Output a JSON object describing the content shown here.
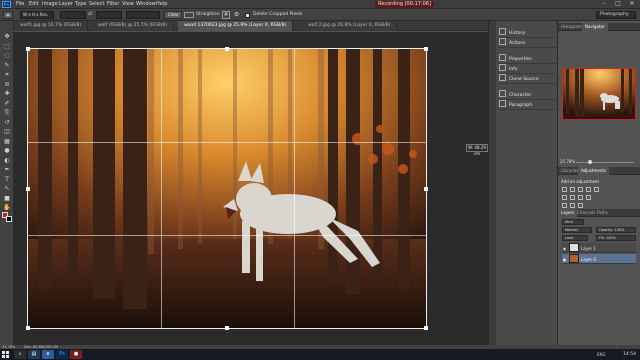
{
  "app": {
    "logo": "Ps"
  },
  "menu": [
    "File",
    "Edit",
    "Image",
    "Layer",
    "Type",
    "Select",
    "Filter",
    "View",
    "Window",
    "Help"
  ],
  "recording": "Recording [00:17:06]",
  "window_controls": [
    "–",
    "□",
    "✕"
  ],
  "options_bar": {
    "ratio": "W x H x Res.",
    "clear": "Clear",
    "straighten": "Straighten",
    "delete_cropped": "Delete Cropped Pixels",
    "workspace": "Photography"
  },
  "tabs": [
    {
      "label": "wolf1.jpg @ 16.7% (RGB/8)",
      "active": false
    },
    {
      "label": "wolf (RGB/8) @ 25.7% (RGB/8)",
      "active": false
    },
    {
      "label": "wood 1370623.jpg @ 25.9% (Layer 0, RGB/8)",
      "active": true
    },
    {
      "label": "wolf 2.jpg @ 26.8% (Layer 0, RGB/8)",
      "active": false
    }
  ],
  "tools": [
    "move-icon",
    "marquee-icon",
    "lasso-icon",
    "quick-select-icon",
    "crop-icon",
    "eyedropper-icon",
    "healing-icon",
    "brush-icon",
    "stamp-icon",
    "history-brush-icon",
    "eraser-icon",
    "gradient-icon",
    "blur-icon",
    "dodge-icon",
    "pen-icon",
    "type-icon",
    "path-select-icon",
    "shape-icon",
    "hand-icon",
    "zoom-icon"
  ],
  "tool_glyphs": [
    "✥",
    "⬚",
    "◌",
    "✎",
    "⌗",
    "⊘",
    "✚",
    "✐",
    "⎘",
    "↺",
    "◫",
    "▦",
    "●",
    "◐",
    "✒",
    "T",
    "↖",
    "■",
    "✋",
    "⌕"
  ],
  "colors": {
    "foreground": "#cc1f1f",
    "background": "#000000",
    "accent": "#2fa3ff"
  },
  "canvas": {
    "size_tooltip": "W: 48.29 cm"
  },
  "mid_panel": [
    "History",
    "Actions",
    "Properties",
    "Info",
    "Clone Source",
    "Character",
    "Paragraph"
  ],
  "right": {
    "top_tabs": [
      "Histogram",
      "Navigator"
    ],
    "nav_zoom": "25.78%",
    "adj_tabs": [
      "Libraries",
      "Adjustments"
    ],
    "adj_title": "Add an adjustment",
    "layer_tabs": [
      "Layers",
      "Channels",
      "Paths"
    ],
    "kind": "Kind",
    "blend": "Normal",
    "opacity": "Opacity: 100%",
    "lock": "Lock:",
    "fill": "Fill: 100%",
    "layers": [
      {
        "name": "Layer 1",
        "active": false
      },
      {
        "name": "Layer 0",
        "active": true
      }
    ]
  },
  "status": {
    "zoom": "25.78%",
    "doc": "Doc: 60.8M/189.2M"
  },
  "taskbar": {
    "lang": "ENG",
    "clock": "14:54"
  }
}
